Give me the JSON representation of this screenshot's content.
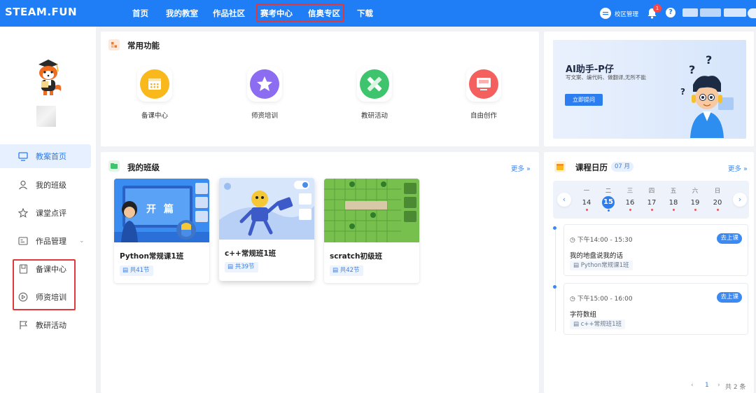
{
  "header": {
    "brand": "STEAM.FUN",
    "nav": [
      "首页",
      "我的教室",
      "作品社区",
      "赛考中心",
      "信奥专区",
      "下载"
    ],
    "campus_label": "校区管理",
    "notification_count": "1",
    "help_icon": "question-icon"
  },
  "sidebar": {
    "items": [
      {
        "label": "教案首页",
        "icon": "monitor-icon"
      },
      {
        "label": "我的班级",
        "icon": "user-icon"
      },
      {
        "label": "课堂点评",
        "icon": "star-icon"
      },
      {
        "label": "作品管理",
        "icon": "card-icon"
      },
      {
        "label": "备课中心",
        "icon": "book-icon"
      },
      {
        "label": "师资培训",
        "icon": "play-icon"
      },
      {
        "label": "教研活动",
        "icon": "flag-icon"
      }
    ]
  },
  "common": {
    "title": "常用功能",
    "items": [
      {
        "label": "备课中心",
        "color": "#f9b81c"
      },
      {
        "label": "师资培训",
        "color": "#8c6cf0"
      },
      {
        "label": "教研活动",
        "color": "#3ec46d"
      },
      {
        "label": "自由创作",
        "color": "#f4605e"
      }
    ]
  },
  "ai": {
    "title": "AI助手-P仔",
    "subtitle": "写文案、编代码、做翻译,无所不能",
    "button": "立即提问"
  },
  "classes": {
    "title": "我的班级",
    "more": "更多 »",
    "cover_text": "开 篇",
    "items": [
      {
        "name": "Python常规课1班",
        "lessons": "共41节"
      },
      {
        "name": "c++常规班1班",
        "lessons": "共39节"
      },
      {
        "name": "scratch初级班",
        "lessons": "共42节"
      }
    ]
  },
  "calendar": {
    "title": "课程日历",
    "month": "07 月",
    "more": "更多 »",
    "weekdays": [
      "一",
      "二",
      "三",
      "四",
      "五",
      "六",
      "日"
    ],
    "days": [
      "14",
      "15",
      "16",
      "17",
      "18",
      "19",
      "20"
    ],
    "selected": "15",
    "events": [
      {
        "time": "下午14:00 - 15:30",
        "name": "我的地盘说我的话",
        "class": "Python常规课1班",
        "action": "去上课"
      },
      {
        "time": "下午15:00 - 16:00",
        "name": "字符数组",
        "class": "c++常规班1班",
        "action": "去上课"
      }
    ],
    "pager_current": "1",
    "pager_total": "共 2 条"
  },
  "colors": {
    "primary": "#1f7ef5",
    "highlight": "#e1393b"
  }
}
